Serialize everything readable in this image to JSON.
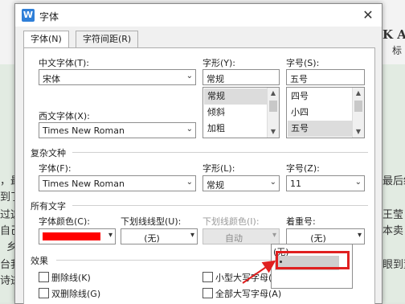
{
  "background": {
    "ribbon_right": "K Aa",
    "ribbon_right2": "标",
    "doc_lines_left": [
      "，最",
      "到了",
      "过这",
      "自己",
      "乡",
      "台我",
      "诗逝"
    ],
    "doc_lines_right": [
      "最后统",
      "王莹",
      "本卖",
      "眼到董"
    ]
  },
  "dialog": {
    "title": "字体",
    "app_icon": "W",
    "close_glyph": "✕",
    "tabs": [
      {
        "label": "字体(N)"
      },
      {
        "label": "字符间距(R)"
      }
    ],
    "chinese_font": {
      "label": "中文字体(T):",
      "value": "宋体"
    },
    "style": {
      "label": "字形(Y):",
      "value": "常规",
      "options": [
        "常规",
        "倾斜",
        "加粗"
      ],
      "selected": "常规"
    },
    "size": {
      "label": "字号(S):",
      "value": "五号",
      "options": [
        "四号",
        "小四",
        "五号"
      ],
      "selected": "五号"
    },
    "western_font": {
      "label": "西文字体(X):",
      "value": "Times New Roman"
    },
    "complex": {
      "section_title": "复杂文种",
      "font_label": "字体(F):",
      "font_value": "Times New Roman",
      "style_label": "字形(L):",
      "style_value": "常规",
      "size_label": "字号(Z):",
      "size_value": "11"
    },
    "all_text": {
      "section_title": "所有文字",
      "color_label": "字体颜色(C):",
      "font_color": "#ff0000",
      "underline_label": "下划线线型(U):",
      "underline_value": "(无)",
      "underline_color_label": "下划线颜色(I):",
      "underline_color_value": "自动",
      "emphasis_label": "着重号:",
      "emphasis_value": "(无)"
    },
    "effects": {
      "section_title": "效果",
      "strikethrough": "删除线(K)",
      "double_strikethrough": "双删除线(G)",
      "small_caps": "小型大写字母(M)",
      "all_caps": "全部大写字母(A)"
    },
    "emphasis_popup": {
      "options": [
        "(无)",
        "."
      ],
      "highlighted": "."
    }
  }
}
